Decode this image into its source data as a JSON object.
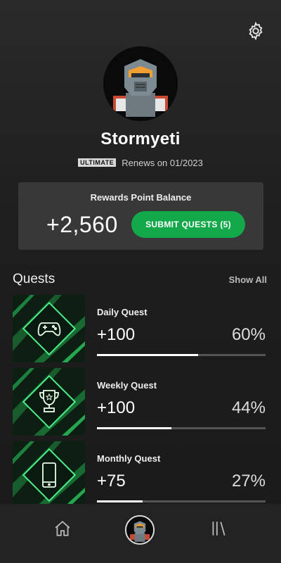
{
  "profile": {
    "gamertag": "Stormyeti",
    "membership_badge": "ULTIMATE",
    "renews_text": "Renews on 01/2023"
  },
  "rewards": {
    "title": "Rewards Point Balance",
    "points": "+2,560",
    "submit_label": "SUBMIT QUESTS (5)"
  },
  "quests": {
    "title": "Quests",
    "show_all": "Show All",
    "items": [
      {
        "name": "Daily Quest",
        "points": "+100",
        "percent_label": "60%",
        "progress": 0.6,
        "icon": "controller-icon"
      },
      {
        "name": "Weekly Quest",
        "points": "+100",
        "percent_label": "44%",
        "progress": 0.44,
        "icon": "trophy-icon"
      },
      {
        "name": "Monthly Quest",
        "points": "+75",
        "percent_label": "27%",
        "progress": 0.27,
        "icon": "phone-icon"
      }
    ]
  },
  "nav": {
    "items": [
      "home-icon",
      "profile-avatar",
      "library-icon"
    ]
  },
  "colors": {
    "accent": "#13a84a",
    "background": "#1e1e1e",
    "card": "#383838"
  }
}
